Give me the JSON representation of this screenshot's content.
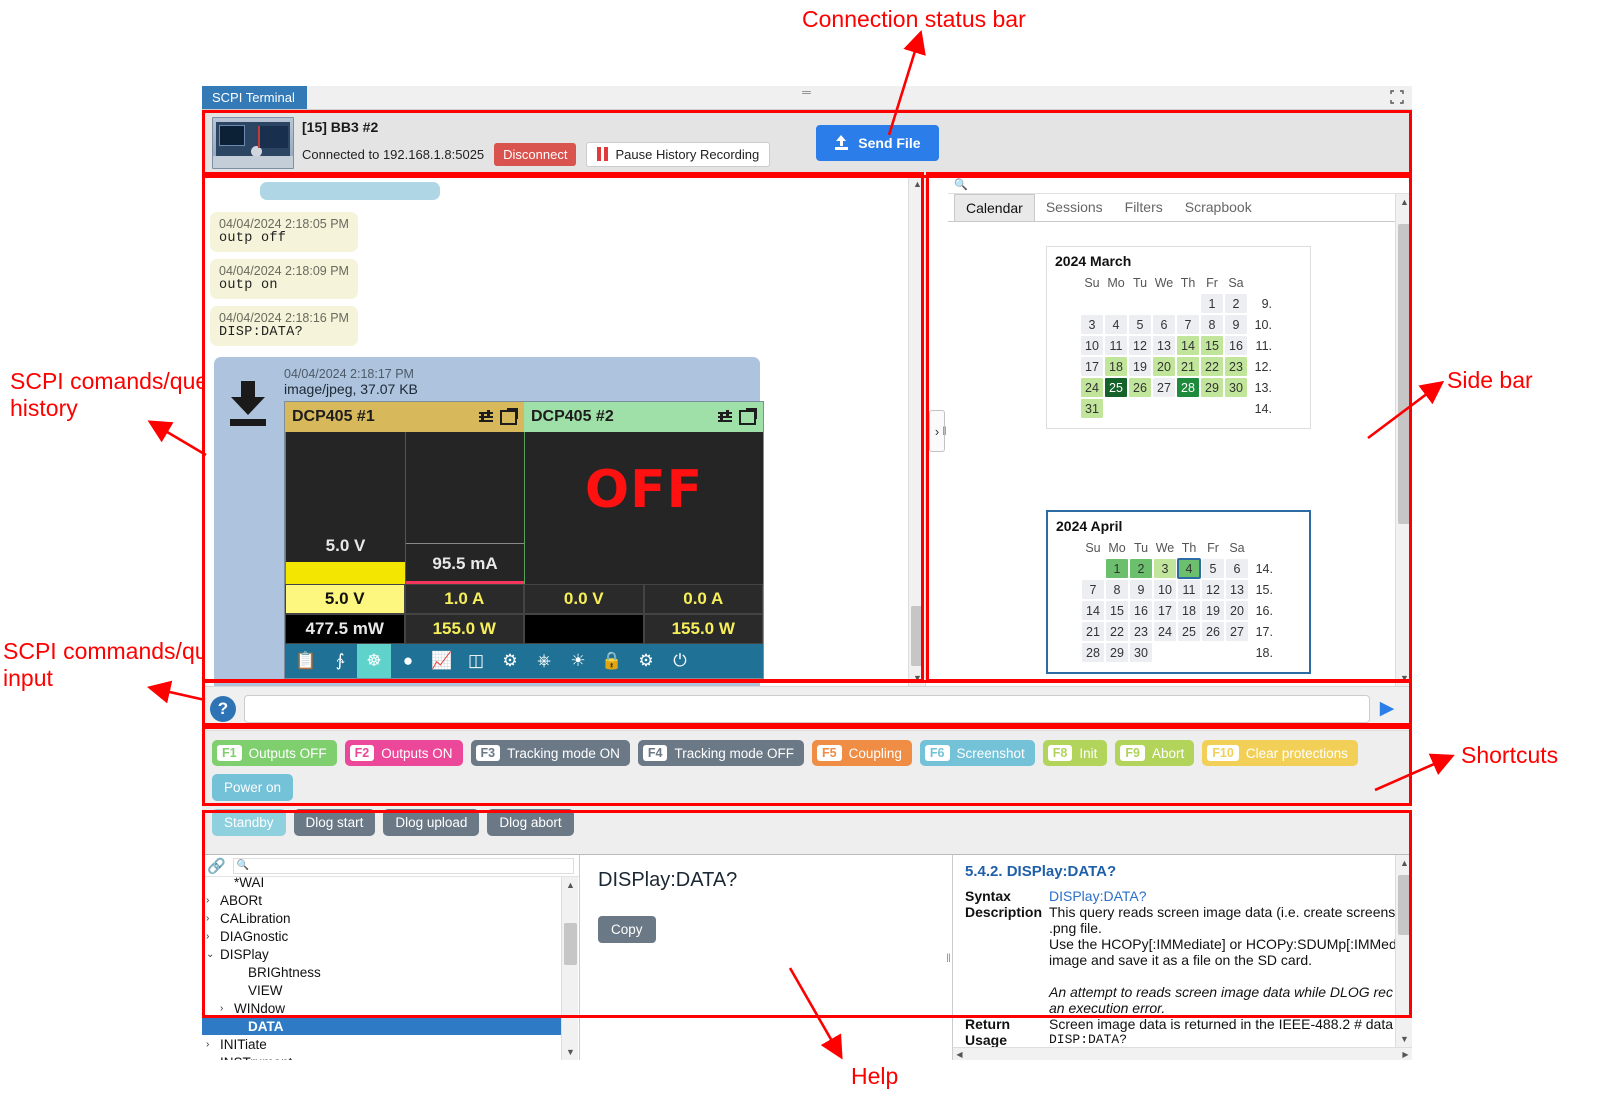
{
  "annotations": {
    "connection_status_bar": "Connection status bar",
    "history": "SCPI comands/query\nhistory",
    "input": "SCPI commands/query\ninput",
    "sidebar": "Side bar",
    "shortcuts": "Shortcuts",
    "help": "Help"
  },
  "window": {
    "tab_label": "SCPI Terminal",
    "expand_icon": "fullscreen-icon"
  },
  "connection": {
    "device_title": "[15] BB3 #2",
    "status_text": "Connected to 192.168.1.8:5025",
    "disconnect_label": "Disconnect",
    "pause_label": "Pause History Recording",
    "send_file_label": "Send File"
  },
  "history": {
    "entries": [
      {
        "timestamp": "04/04/2024 2:18:05 PM",
        "command": "outp off"
      },
      {
        "timestamp": "04/04/2024 2:18:09 PM",
        "command": "outp on"
      },
      {
        "timestamp": "04/04/2024 2:18:16 PM",
        "command": "DISP:DATA?"
      }
    ],
    "file_entry": {
      "timestamp": "04/04/2024 2:18:17 PM",
      "filetype": "image/jpeg, 37.07 KB"
    }
  },
  "device_screen": {
    "ch1": {
      "title": "DCP405 #1",
      "mon_voltage": "5.0 V",
      "mon_current": "95.5 mA",
      "set_voltage": "5.0 V",
      "set_current": "1.0 A",
      "power": "477.5 mW",
      "power_limit": "155.0 W"
    },
    "ch2": {
      "title": "DCP405 #2",
      "off_text": "OFF",
      "set_voltage": "0.0 V",
      "set_current": "0.0 A",
      "power": "",
      "power_limit": "155.0 W"
    },
    "toolbar_icons": [
      "event-log-icon",
      "usb-icon",
      "ethernet-icon",
      "record-icon",
      "trend-chart-icon",
      "display-view-icon",
      "io-settings-icon",
      "function-generator-icon",
      "dcm-icon",
      "lock-icon",
      "settings-gear-icon",
      "power-icon"
    ],
    "below_icons": [
      "save-icon",
      "copy-icon",
      "comment-icon"
    ]
  },
  "sidebar": {
    "search_placeholder": "",
    "tabs": [
      {
        "label": "Calendar",
        "active": true
      },
      {
        "label": "Sessions",
        "active": false
      },
      {
        "label": "Filters",
        "active": false
      },
      {
        "label": "Scrapbook",
        "active": false
      }
    ],
    "calendars": [
      {
        "title": "2024 March",
        "weekday_headers": [
          "Su",
          "Mo",
          "Tu",
          "We",
          "Th",
          "Fr",
          "Sa"
        ],
        "week_numbers": [
          "9.",
          "10.",
          "11.",
          "12.",
          "13.",
          "14."
        ],
        "weeks": [
          [
            null,
            null,
            null,
            null,
            null,
            "1",
            "2"
          ],
          [
            "3",
            "4",
            "5",
            "6",
            "7",
            "8",
            "9"
          ],
          [
            "10",
            "11",
            "12",
            "13",
            "14",
            "15",
            "16"
          ],
          [
            "17",
            "18",
            "19",
            "20",
            "21",
            "22",
            "23"
          ],
          [
            "24",
            "25",
            "26",
            "27",
            "28",
            "29",
            "30"
          ],
          [
            "31",
            null,
            null,
            null,
            null,
            null,
            null
          ]
        ],
        "highlight_light": [
          "14",
          "15",
          "18",
          "20",
          "21",
          "22",
          "23",
          "24",
          "26",
          "29",
          "30",
          "31"
        ],
        "highlight_dark": [
          "28"
        ],
        "highlight_darkest": [
          "25"
        ],
        "selected": false
      },
      {
        "title": "2024 April",
        "weekday_headers": [
          "Su",
          "Mo",
          "Tu",
          "We",
          "Th",
          "Fr",
          "Sa"
        ],
        "week_numbers": [
          "14.",
          "15.",
          "16.",
          "17.",
          "18."
        ],
        "weeks": [
          [
            null,
            "1",
            "2",
            "3",
            "4",
            "5",
            "6"
          ],
          [
            "7",
            "8",
            "9",
            "10",
            "11",
            "12",
            "13"
          ],
          [
            "14",
            "15",
            "16",
            "17",
            "18",
            "19",
            "20"
          ],
          [
            "21",
            "22",
            "23",
            "24",
            "25",
            "26",
            "27"
          ],
          [
            "28",
            "29",
            "30",
            null,
            null,
            null,
            null
          ]
        ],
        "highlight_light": [
          "3"
        ],
        "highlight_mid": [
          "1",
          "2",
          "4"
        ],
        "today": "4",
        "selected": true
      }
    ]
  },
  "input_bar": {
    "help_icon": "question-mark-icon",
    "value": "",
    "placeholder": "",
    "send_icon": "send-play-icon"
  },
  "shortcuts": {
    "rows": [
      [
        {
          "key": "F1",
          "label": "Outputs OFF",
          "color": "#7fcf6f"
        },
        {
          "key": "F2",
          "label": "Outputs ON",
          "color": "#ec4899"
        },
        {
          "key": "F3",
          "label": "Tracking mode ON",
          "color": "#6b7886"
        },
        {
          "key": "F4",
          "label": "Tracking mode OFF",
          "color": "#6b7886"
        },
        {
          "key": "F5",
          "label": "Coupling",
          "color": "#ee8d43"
        },
        {
          "key": "F6",
          "label": "Screenshot",
          "color": "#74c2d8"
        },
        {
          "key": "F8",
          "label": "Init",
          "color": "#aed martial"
        },
        {
          "key": "F9",
          "label": "Abort",
          "color": "#b2d45b"
        },
        {
          "key": "F10",
          "label": "Clear protections",
          "color": "#f2d058"
        },
        {
          "key": "",
          "label": "Power on",
          "color": "#74c2d8"
        }
      ],
      [
        {
          "key": "",
          "label": "Standby",
          "color": "#8fd0de"
        },
        {
          "key": "",
          "label": "Dlog start",
          "color": "#6b7886"
        },
        {
          "key": "",
          "label": "Dlog upload",
          "color": "#6b7886"
        },
        {
          "key": "",
          "label": "Dlog abort",
          "color": "#6b7886"
        }
      ]
    ]
  },
  "help": {
    "link_icon": "chain-link-icon",
    "search_placeholder": "",
    "tree": [
      {
        "label": "*WAI",
        "indent": 1,
        "chev": "",
        "selected": false
      },
      {
        "label": "ABORt",
        "indent": 0,
        "chev": "›",
        "selected": false
      },
      {
        "label": "CALibration",
        "indent": 0,
        "chev": "›",
        "selected": false
      },
      {
        "label": "DIAGnostic",
        "indent": 0,
        "chev": "›",
        "selected": false
      },
      {
        "label": "DISPlay",
        "indent": 0,
        "chev": "⌄",
        "selected": false
      },
      {
        "label": "BRIGhtness",
        "indent": 2,
        "chev": "",
        "selected": false
      },
      {
        "label": "VIEW",
        "indent": 2,
        "chev": "",
        "selected": false
      },
      {
        "label": "WINdow",
        "indent": 1,
        "chev": "›",
        "selected": false
      },
      {
        "label": "DATA",
        "indent": 2,
        "chev": "",
        "selected": true
      },
      {
        "label": "INITiate",
        "indent": 0,
        "chev": "›",
        "selected": false
      },
      {
        "label": "INSTrument",
        "indent": 0,
        "chev": "›",
        "selected": false
      }
    ],
    "command_name": "DISPlay:DATA?",
    "copy_label": "Copy",
    "doc": {
      "heading": "5.4.2. DISPlay:DATA?",
      "syntax_label": "Syntax",
      "syntax_value": "DISPlay:DATA?",
      "description_label": "Description",
      "description_lines": [
        "This query reads screen image data (i.e. create screens",
        ".png file.",
        "Use the HCOPy[:IMMediate] or HCOPy:SDUMp[:IMMed",
        "image and save it as a file on the SD card."
      ],
      "note_lines": [
        "An attempt to reads screen image data while DLOG rec",
        "an execution error."
      ],
      "return_label": "Return",
      "return_value": "Screen image data is returned in the IEEE-488.2 # data",
      "usage_label": "Usage",
      "usage_value": "DISP:DATA?"
    }
  }
}
